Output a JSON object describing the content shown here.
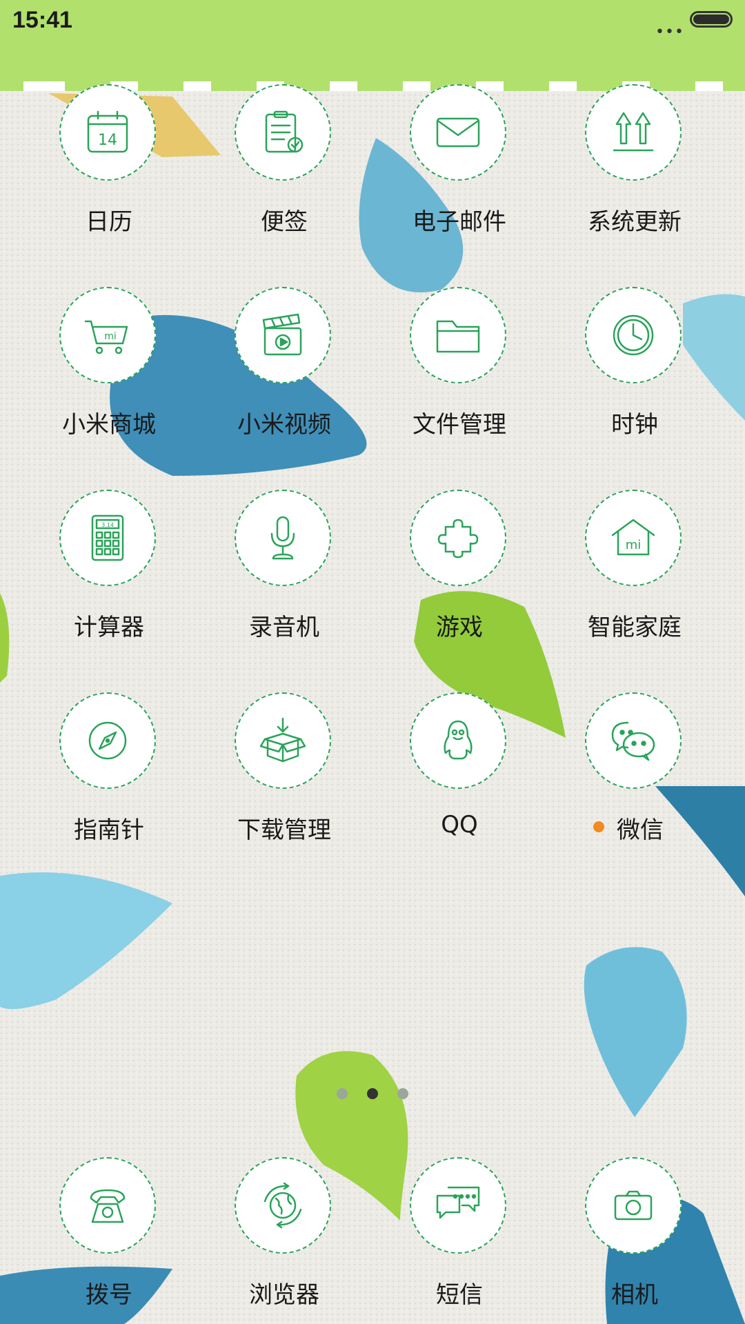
{
  "status_bar": {
    "time": "15:41",
    "signal_dots": "•••",
    "battery_icon": "battery-full-icon"
  },
  "colors": {
    "status_bar_bg": "#b2e06d",
    "icon_stroke": "#2aa35a",
    "badge": "#f28a1e"
  },
  "apps": [
    {
      "label": "日历",
      "icon": "calendar-icon",
      "calendar_day": "14"
    },
    {
      "label": "便签",
      "icon": "notes-clipboard-icon"
    },
    {
      "label": "电子邮件",
      "icon": "email-envelope-icon"
    },
    {
      "label": "系统更新",
      "icon": "system-update-arrows-icon"
    },
    {
      "label": "小米商城",
      "icon": "shopping-cart-icon"
    },
    {
      "label": "小米视频",
      "icon": "video-clapper-icon"
    },
    {
      "label": "文件管理",
      "icon": "folder-icon"
    },
    {
      "label": "时钟",
      "icon": "clock-icon"
    },
    {
      "label": "计算器",
      "icon": "calculator-icon",
      "calc_display": "3.14"
    },
    {
      "label": "录音机",
      "icon": "microphone-icon"
    },
    {
      "label": "游戏",
      "icon": "puzzle-piece-icon"
    },
    {
      "label": "智能家庭",
      "icon": "smart-home-icon"
    },
    {
      "label": "指南针",
      "icon": "compass-icon"
    },
    {
      "label": "下载管理",
      "icon": "download-box-icon"
    },
    {
      "label": "QQ",
      "icon": "qq-penguin-icon"
    },
    {
      "label": "微信",
      "icon": "wechat-icon",
      "badge": true
    }
  ],
  "page_indicator": {
    "pages": 3,
    "current": 2
  },
  "dock": [
    {
      "label": "拨号",
      "icon": "phone-dialer-icon"
    },
    {
      "label": "浏览器",
      "icon": "browser-globe-icon"
    },
    {
      "label": "短信",
      "icon": "messages-icon"
    },
    {
      "label": "相机",
      "icon": "camera-icon"
    }
  ]
}
